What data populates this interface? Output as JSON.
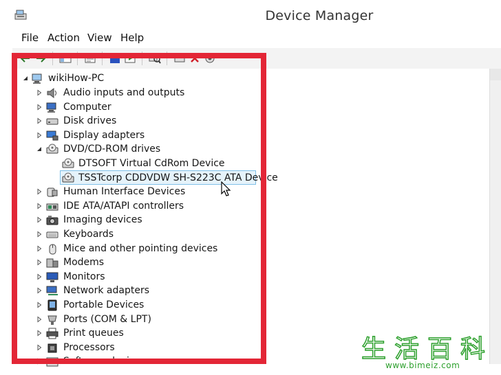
{
  "window": {
    "title": "Device Manager"
  },
  "menu": [
    "File",
    "Action",
    "View",
    "Help"
  ],
  "tree": {
    "root": "wikiHow-PC",
    "categories": [
      {
        "label": "Audio inputs and outputs",
        "icon": "speaker-icon"
      },
      {
        "label": "Computer",
        "icon": "computer-icon"
      },
      {
        "label": "Disk drives",
        "icon": "disk-drive-icon"
      },
      {
        "label": "Display adapters",
        "icon": "display-adapter-icon"
      },
      {
        "label": "DVD/CD-ROM drives",
        "icon": "dvd-drive-icon",
        "expanded": true,
        "children": [
          {
            "label": "DTSOFT Virtual CdRom Device",
            "icon": "dvd-drive-icon"
          },
          {
            "label": "TSSTcorp CDDVDW SH-S223C ATA Device",
            "icon": "dvd-drive-icon",
            "selected": true
          }
        ]
      },
      {
        "label": "Human Interface Devices",
        "icon": "hid-icon"
      },
      {
        "label": "IDE ATA/ATAPI controllers",
        "icon": "ide-controller-icon"
      },
      {
        "label": "Imaging devices",
        "icon": "camera-icon"
      },
      {
        "label": "Keyboards",
        "icon": "keyboard-icon"
      },
      {
        "label": "Mice and other pointing devices",
        "icon": "mouse-icon"
      },
      {
        "label": "Modems",
        "icon": "modem-icon"
      },
      {
        "label": "Monitors",
        "icon": "monitor-icon"
      },
      {
        "label": "Network adapters",
        "icon": "network-adapter-icon"
      },
      {
        "label": "Portable Devices",
        "icon": "portable-device-icon"
      },
      {
        "label": "Ports (COM & LPT)",
        "icon": "port-icon"
      },
      {
        "label": "Print queues",
        "icon": "printer-icon"
      },
      {
        "label": "Processors",
        "icon": "processor-icon"
      },
      {
        "label": "Software devices",
        "icon": "software-device-icon"
      }
    ]
  },
  "watermark": {
    "logo_text": "生活百科",
    "url": "www.bimeiz.com"
  },
  "colors": {
    "highlight": "#e32636",
    "selection_bg": "#e5f3fb",
    "selection_border": "#7fc0e8",
    "watermark": "#2da02d"
  }
}
